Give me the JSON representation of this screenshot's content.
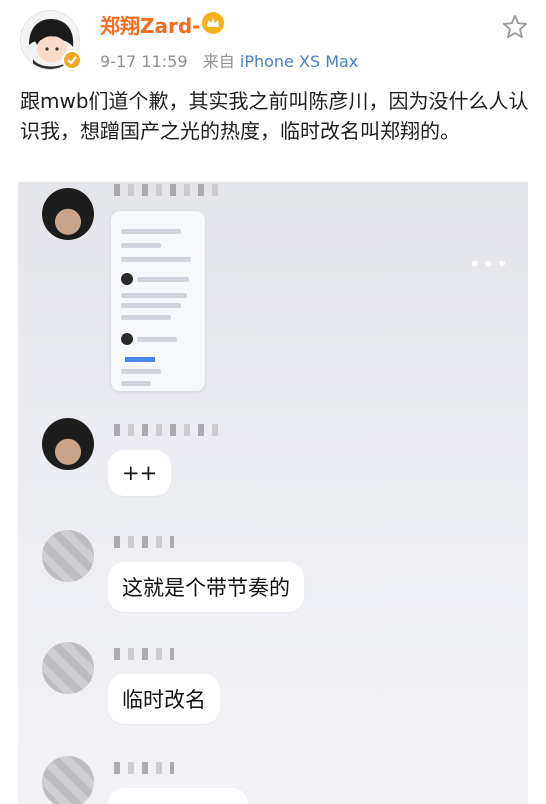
{
  "post": {
    "author": "郑翔Zard-",
    "time": "9-17 11:59",
    "source_prefix": "来自",
    "source_device": "iPhone XS Max",
    "text": "跟mwb们道个歉，其实我之前叫陈彦川，因为没什么人认识我，想蹭国产之光的热度，临时改名叫郑翔的。"
  },
  "chat": {
    "more": "•••",
    "messages": [
      {
        "text": "++"
      },
      {
        "text": "这就是个带节奏的"
      },
      {
        "text": "临时改名"
      }
    ]
  },
  "colors": {
    "username": "#f66d1f",
    "source_link": "#4b7fc4",
    "verified_badge": "#f5a623"
  },
  "icons": {
    "avatar": "cartoon-avatar",
    "verified": "verified-badge-icon",
    "vip": "crown-icon",
    "follow": "star-icon"
  }
}
